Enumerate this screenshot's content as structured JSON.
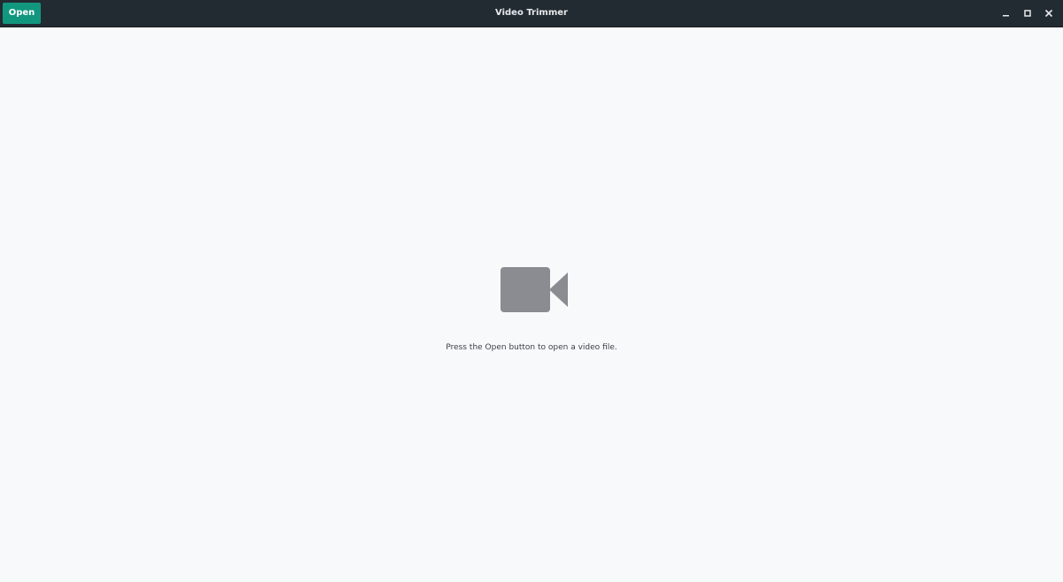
{
  "headerbar": {
    "open_label": "Open",
    "title": "Video Trimmer"
  },
  "window_controls": {
    "minimize_icon": "minimize-icon",
    "maximize_icon": "maximize-icon",
    "close_icon": "close-icon"
  },
  "empty_state": {
    "icon": "video-camera-icon",
    "message": "Press the Open button to open a video file."
  },
  "colors": {
    "headerbar_bg": "#232b32",
    "accent": "#12977f",
    "content_bg": "#f8f9fb",
    "icon_gray": "#8a8c91"
  }
}
